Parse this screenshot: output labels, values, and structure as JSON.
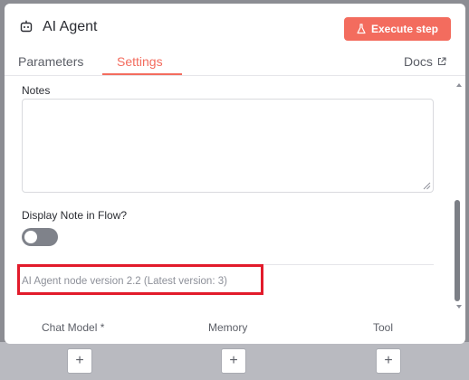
{
  "header": {
    "title": "AI Agent",
    "execute_label": "Execute step",
    "icons": {
      "node": "robot-icon",
      "execute": "flask-icon",
      "docs": "external-link-icon"
    }
  },
  "tabs": [
    {
      "label": "Parameters",
      "active": false
    },
    {
      "label": "Settings",
      "active": true
    }
  ],
  "docs_label": "Docs",
  "settings": {
    "notes_label": "Notes",
    "notes_value": "",
    "display_note_label": "Display Note in Flow?",
    "display_note_enabled": false,
    "version_text": "AI Agent node version 2.2 (Latest version: 3)"
  },
  "ports": [
    {
      "label": "Chat Model *",
      "add_symbol": "+"
    },
    {
      "label": "Memory",
      "add_symbol": "+"
    },
    {
      "label": "Tool",
      "add_symbol": "+"
    }
  ],
  "colors": {
    "accent": "#f36c5e",
    "highlight": "#e21b2b",
    "toggle_off": "#7f828a"
  }
}
